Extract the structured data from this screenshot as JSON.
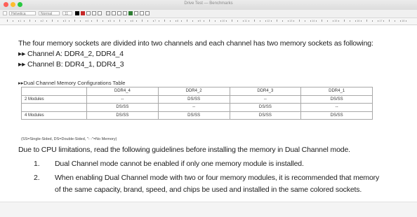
{
  "window": {
    "title": "Drive Test — Benchmarks"
  },
  "toolbar": {
    "style_value": "Helvetica",
    "typeface_value": "Normal",
    "size_value": "11",
    "colors": [
      "#000000",
      "#c62828",
      "#2e7d32"
    ]
  },
  "ruler": {
    "labels": [
      "1",
      "2",
      "3",
      "4",
      "5",
      "6",
      "7",
      "8",
      "9",
      "10",
      "11",
      "12",
      "13",
      "14",
      "15",
      "16",
      "17",
      "18"
    ]
  },
  "document": {
    "intro": "The four memory sockets are divided into two channels and each channel has two memory sockets as following:",
    "channel_a": "▸▸ Channel A: DDR4_2, DDR4_4",
    "channel_b": "▸▸ Channel B: DDR4_1, DDR4_3",
    "table_caption": "▸▸Dual Channel Memory Configurations Table",
    "table": {
      "headers": [
        "",
        "DDR4_4",
        "DDR4_2",
        "DDR4_3",
        "DDR4_1"
      ],
      "rows": [
        [
          "2 Modules",
          "--",
          "DS/SS",
          "--",
          "DS/SS"
        ],
        [
          "",
          "DS/SS",
          "--",
          "DS/SS",
          "--"
        ],
        [
          "4 Modules",
          "DS/SS",
          "DS/SS",
          "DS/SS",
          "DS/SS"
        ]
      ]
    },
    "table_note": "(SS=Single-Sided, DS=Double-Sided, \"- -\"=No Memory)",
    "guidelines_intro": "Due to CPU limitations, read the following guidelines before installing the memory in Dual Channel mode.",
    "guidelines": [
      {
        "number": "1.",
        "line1": "Dual Channel mode cannot be enabled if only one memory module is installed.",
        "line2": ""
      },
      {
        "number": "2.",
        "line1": "When enabling Dual Channel mode with two or four memory modules, it is recommended that memory",
        "line2": "of the same capacity, brand, speed, and chips be used and installed in the same colored sockets."
      }
    ]
  }
}
